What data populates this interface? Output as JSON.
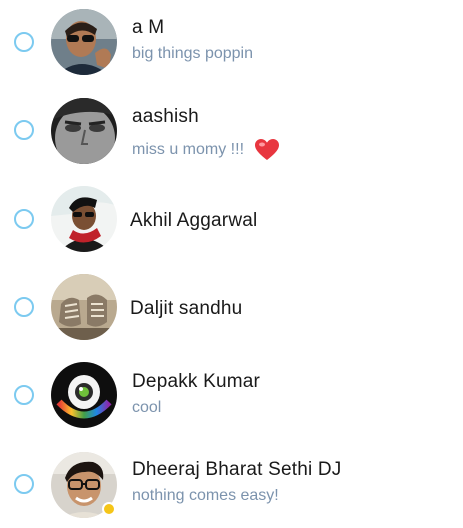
{
  "contacts": [
    {
      "name": "a M",
      "mood": "big things poppin",
      "avatar": "avatar-sunglasses-man"
    },
    {
      "name": "aashish",
      "mood": "miss u momy !!!",
      "emoticon": "heart-icon",
      "avatar": "avatar-grayscale-face"
    },
    {
      "name": "Akhil Aggarwal",
      "mood": "",
      "avatar": "avatar-man-red-scarf"
    },
    {
      "name": "Daljit sandhu",
      "mood": "",
      "avatar": "avatar-sneakers-photo"
    },
    {
      "name": "Depakk Kumar",
      "mood": "cool",
      "avatar": "avatar-eye-logo"
    },
    {
      "name": "Dheeraj Bharat Sethi DJ",
      "mood": "nothing comes easy!",
      "avatar": "avatar-glasses-man",
      "status": "away"
    }
  ],
  "colors": {
    "select_circle": "#7ccaf0",
    "mood_text": "#7c93ad",
    "name_text": "#1a1a1a",
    "away_status": "#f5c518",
    "heart": "#e8363f"
  }
}
